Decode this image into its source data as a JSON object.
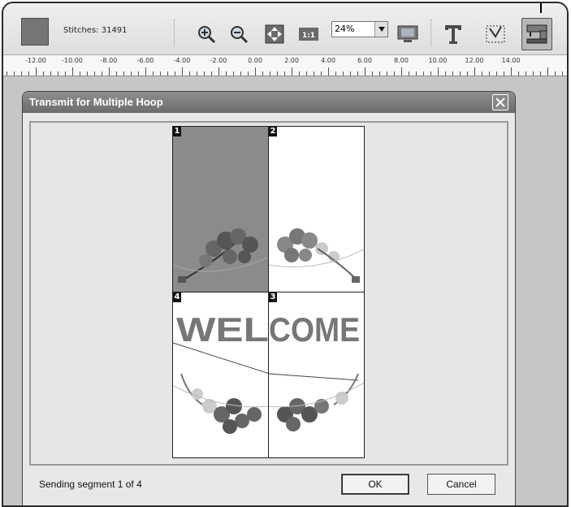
{
  "toolbar": {
    "stitches_label": "Stitches: 31491",
    "zoom_value": "24%",
    "swatch_color": "#767676"
  },
  "icons": [
    "zoom-in-icon",
    "zoom-out-icon",
    "fit-icon",
    "actual-size-icon",
    "view-icon",
    "text-icon",
    "hoop-outline-icon",
    "embroidery-machine-icon"
  ],
  "ruler": {
    "labels": [
      "-12.00",
      "-10.00",
      "-8.00",
      "-6.00",
      "-4.00",
      "-2.00",
      "0.00",
      "2.00",
      "4.00",
      "6.00",
      "8.00",
      "10.00",
      "12.00",
      "14.00"
    ]
  },
  "dialog": {
    "title": "Transmit for Multiple Hoop",
    "segments": [
      {
        "number": "1",
        "state": "sending"
      },
      {
        "number": "2",
        "state": "pending"
      },
      {
        "number": "4",
        "state": "pending"
      },
      {
        "number": "3",
        "state": "pending"
      }
    ],
    "design_text": "WELCOME",
    "status": "Sending segment 1 of 4",
    "ok_label": "OK",
    "cancel_label": "Cancel"
  }
}
